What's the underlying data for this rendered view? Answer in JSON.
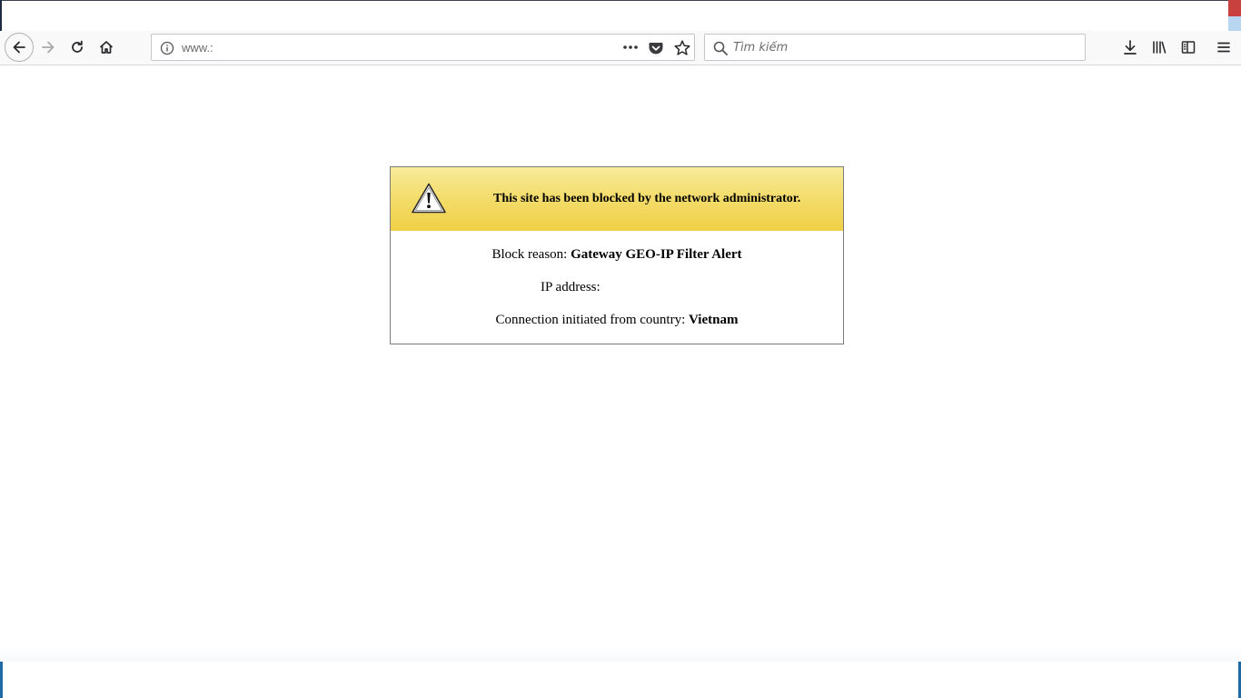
{
  "browser": {
    "url": "www.:",
    "search_placeholder": "Tìm kiếm",
    "icons": {
      "back": "back-arrow-icon",
      "forward": "forward-arrow-icon",
      "reload": "reload-icon",
      "home": "home-icon",
      "info": "info-icon",
      "more": "more-actions-icon",
      "pocket": "pocket-icon",
      "bookmark": "star-icon",
      "search": "search-icon",
      "downloads": "download-icon",
      "library": "library-icon",
      "sidebar": "sidebar-icon",
      "menu": "hamburger-menu-icon"
    }
  },
  "block_page": {
    "title": "This site has been blocked by the network administrator.",
    "reason_label": "Block reason: ",
    "reason_value": "Gateway GEO-IP Filter Alert",
    "ip_label": "IP address:",
    "ip_value": "",
    "country_label": "Connection initiated from country: ",
    "country_value": "Vietnam",
    "warning_icon": "warning-triangle-icon",
    "colors": {
      "header_top": "#f8ec9c",
      "header_bottom": "#efcf45",
      "border": "#7a7a7a"
    }
  }
}
